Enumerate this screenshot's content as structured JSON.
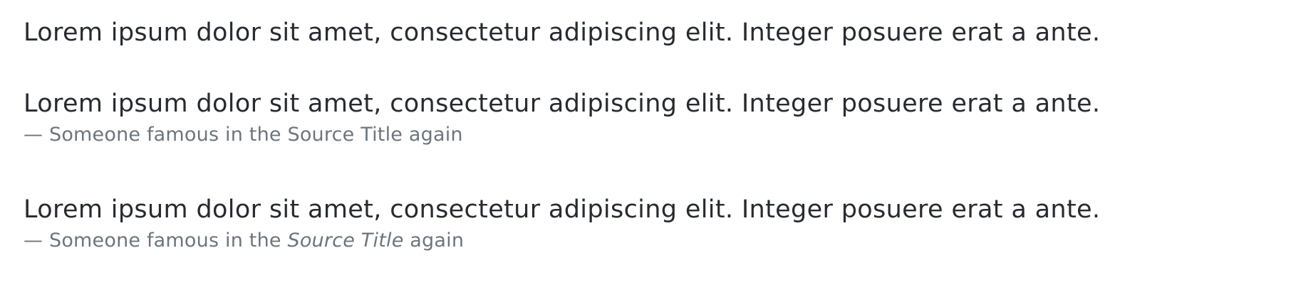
{
  "quotes": [
    {
      "text": "Lorem ipsum dolor sit amet, consectetur adipiscing elit. Integer posuere erat a ante."
    },
    {
      "text": "Lorem ipsum dolor sit amet, consectetur adipiscing elit. Integer posuere erat a ante.",
      "footer": {
        "prefix": "— Someone famous in the ",
        "source_title": "Source Title",
        "suffix": " again"
      }
    },
    {
      "text": "Lorem ipsum dolor sit amet, consectetur adipiscing elit. Integer posuere erat a ante.",
      "footer": {
        "prefix": "— Someone famous in the ",
        "source_title": "Source Title",
        "suffix": " again"
      }
    }
  ],
  "colors": {
    "quote_text": "#272b30",
    "footer_text": "#6c757d",
    "background": "#ffffff"
  }
}
